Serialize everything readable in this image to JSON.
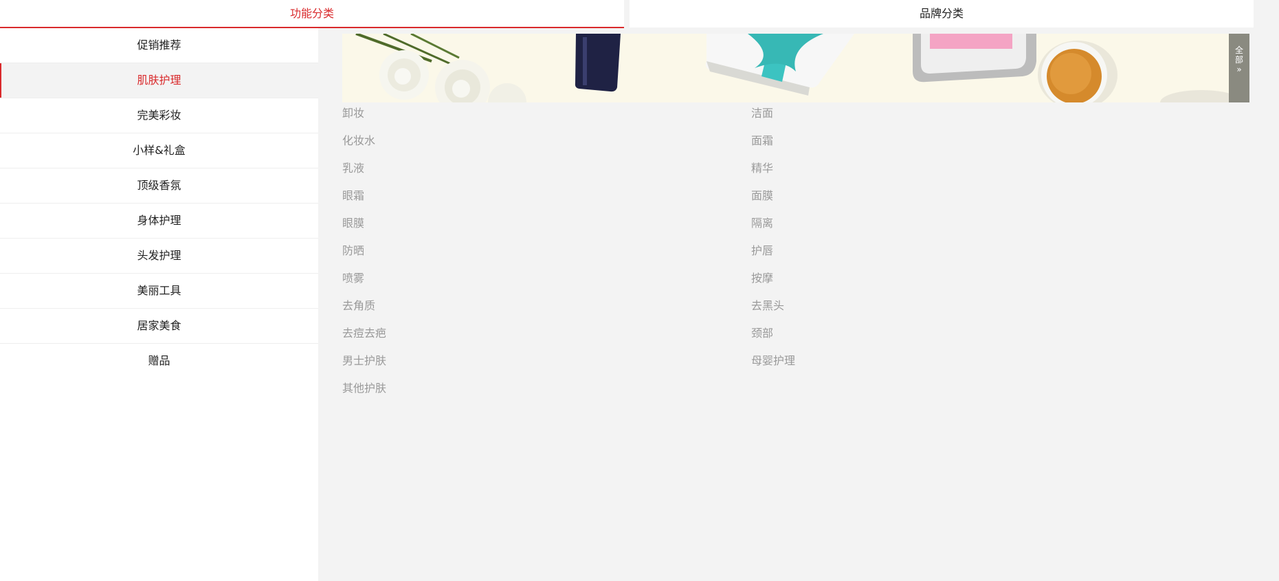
{
  "tabs": [
    "功能分类",
    "品牌分类"
  ],
  "sidebar": {
    "items": [
      "促销推荐",
      "肌肤护理",
      "完美彩妆",
      "小样&礼盒",
      "顶级香氛",
      "身体护理",
      "头发护理",
      "美丽工具",
      "居家美食",
      "赠品"
    ],
    "active_index": 1
  },
  "all_button": {
    "line1": "全",
    "line2": "部",
    "arrow": "»"
  },
  "categories": {
    "left": [
      "卸妆",
      "化妆水",
      "乳液",
      "眼霜",
      "眼膜",
      "防晒",
      "喷雾",
      "去角质",
      "去痘去疤",
      "男士护肤",
      "其他护肤"
    ],
    "right": [
      "洁面",
      "面霜",
      "精华",
      "面膜",
      "隔离",
      "护唇",
      "按摩",
      "去黑头",
      "颈部",
      "母婴护理"
    ]
  },
  "colors": {
    "accent": "#d9292b",
    "muted_text": "#999999",
    "bg": "#f3f3f3"
  }
}
